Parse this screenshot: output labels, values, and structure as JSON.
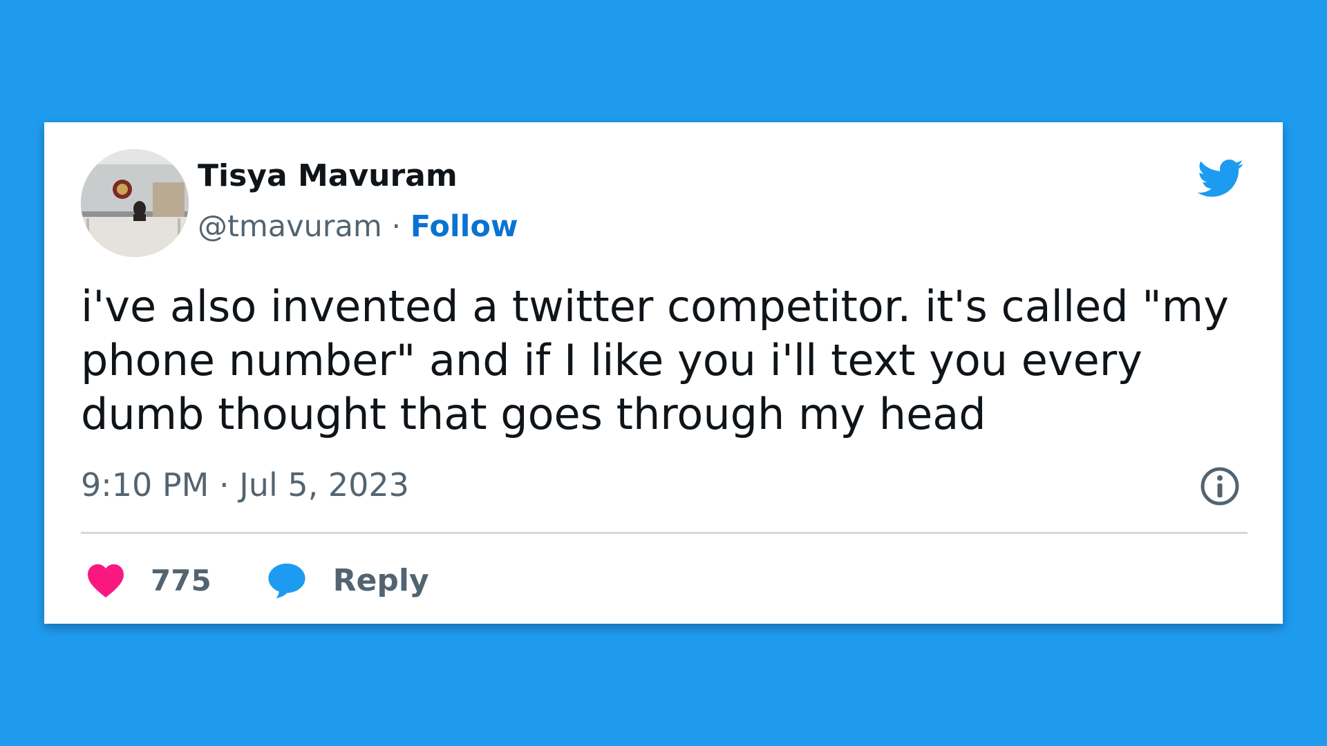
{
  "tweet": {
    "author_name": "Tisya Mavuram",
    "handle": "@tmavuram",
    "separator": "·",
    "follow_label": "Follow",
    "text": "i've also invented a twitter competitor. it's called \"my phone number\" and if I like you i'll text you every dumb thought that goes through my head",
    "time": "9:10 PM",
    "date": "Jul 5, 2023",
    "likes": "775",
    "reply_label": "Reply"
  },
  "icons": {
    "brand": "twitter-bird-icon",
    "info": "info-icon",
    "like": "heart-icon",
    "reply": "speech-bubble-icon"
  },
  "colors": {
    "background": "#1f9bee",
    "card": "#ffffff",
    "text": "#0f1419",
    "secondary_text": "#536471",
    "link": "#0a73d1",
    "heart": "#f91880",
    "bird": "#1d9bf0",
    "divider": "#cfd9de"
  }
}
